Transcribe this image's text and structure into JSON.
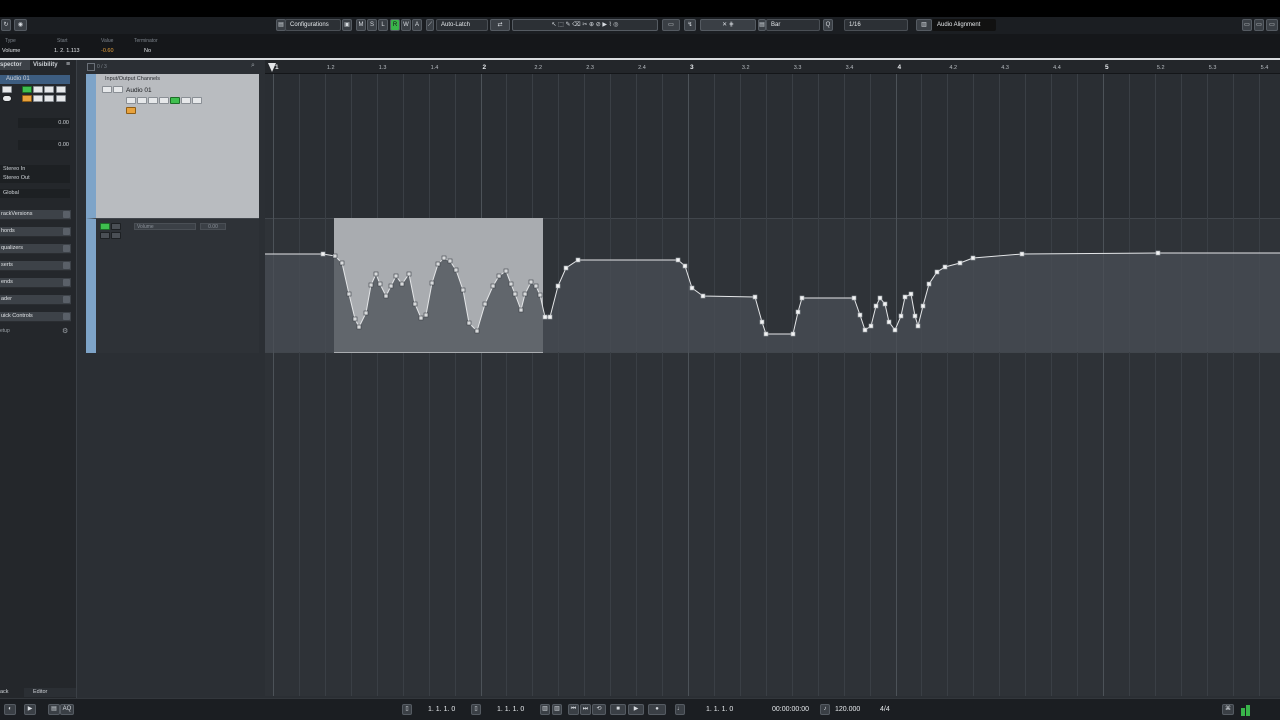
{
  "toolbar": {
    "configurations": "Configurations",
    "mute_label": "M",
    "solo_label": "S",
    "read_label": "R",
    "write_label": "W",
    "a_label": "A",
    "automation_mode": "Auto-Latch",
    "grid_type": "Bar",
    "quantize": "1/16",
    "audio_alignment": "Audio Alignment"
  },
  "infoline": {
    "type_caption": "Type",
    "type_value": "Volume",
    "start_caption": "Start",
    "start_value": "1. 2. 1.113",
    "value_caption": "Value",
    "value_value": "-0.60",
    "terminator_caption": "Terminator",
    "terminator_value": "No"
  },
  "inspector": {
    "tab_inspector": "spector",
    "tab_visibility": "Visibility",
    "track_name": "Audio 01",
    "volume_value": "0.00",
    "pan_value": "0.00",
    "input": "Stereo In",
    "output": "Stereo Out",
    "global": "Global",
    "sections": [
      "rackVersions",
      "hords",
      "qualizers",
      "serts",
      "ends",
      "ader",
      "uick Controls"
    ],
    "setup": "etup",
    "bottom_tab_left": "ack",
    "bottom_tab_editor": "Editor"
  },
  "tracklist": {
    "folder_title": "Input/Output Channels",
    "track_name": "Audio 01",
    "lane_param": "Volume",
    "lane_value": "0.00",
    "counter": "0 / 3"
  },
  "ruler": {
    "labels": [
      "1",
      "1.2",
      "1.3",
      "1.4",
      "2",
      "2.2",
      "2.3",
      "2.4",
      "3",
      "3.2",
      "3.3",
      "3.4",
      "4",
      "4.2",
      "4.3",
      "4.4",
      "5",
      "5.2",
      "5.3",
      "5.4"
    ]
  },
  "transport": {
    "left_locator": "1. 1. 1.   0",
    "right_locator": "1. 1. 1.   0",
    "position_bars": "1. 1. 1.   0",
    "position_time": "00:00:00:00",
    "tempo": "120.000",
    "signature": "4/4"
  },
  "colors": {
    "accent_green": "#39b54a",
    "track_color": "#7ea4c8",
    "value_orange": "#e8a23c",
    "selection": "#a9acb0"
  }
}
